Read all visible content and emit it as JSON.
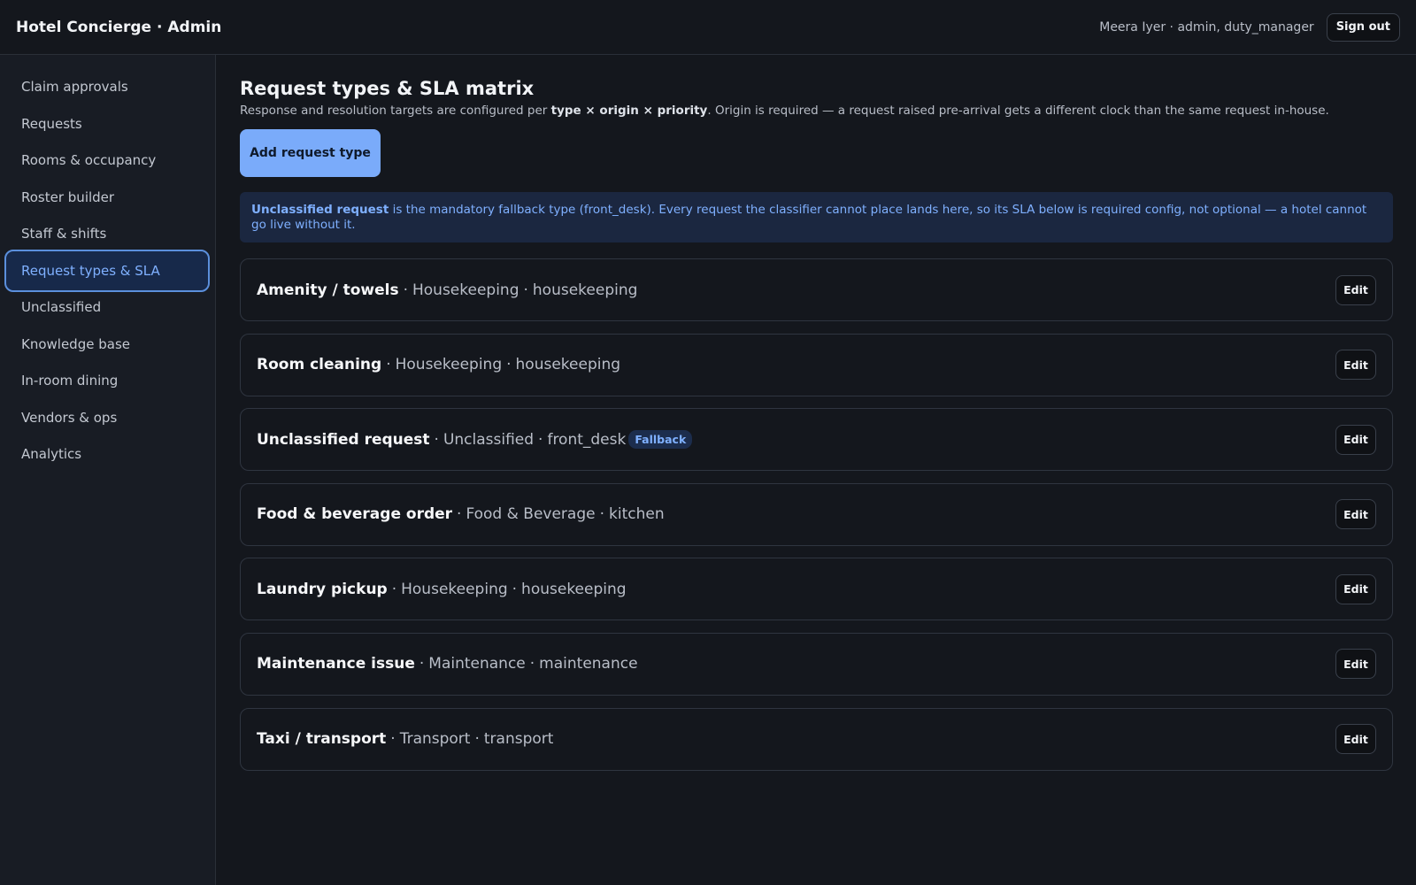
{
  "header": {
    "title": "Hotel Concierge · Admin",
    "user": "Meera Iyer · admin, duty_manager",
    "signout_label": "Sign out"
  },
  "sidebar": {
    "items": [
      {
        "label": "Claim approvals"
      },
      {
        "label": "Requests"
      },
      {
        "label": "Rooms & occupancy"
      },
      {
        "label": "Roster builder"
      },
      {
        "label": "Staff & shifts"
      },
      {
        "label": "Request types & SLA",
        "active": true
      },
      {
        "label": "Unclassified"
      },
      {
        "label": "Knowledge base"
      },
      {
        "label": "In-room dining"
      },
      {
        "label": "Vendors & ops"
      },
      {
        "label": "Analytics"
      }
    ]
  },
  "main": {
    "title": "Request types & SLA matrix",
    "subtitle_prefix": "Response and resolution targets are configured per ",
    "subtitle_bold": "type × origin × priority",
    "subtitle_suffix": ". Origin is required — a request raised pre-arrival gets a different clock than the same request in-house.",
    "add_button_label": "Add request type",
    "notice_bold": "Unclassified request",
    "notice_text": " is the mandatory fallback type (front_desk). Every request the classifier cannot place lands here, so its SLA below is required config, not optional — a hotel cannot go live without it.",
    "edit_label": "Edit",
    "separator": "·",
    "request_types": [
      {
        "name": "Amenity / towels",
        "category": "Housekeeping",
        "team": "housekeeping",
        "badge": ""
      },
      {
        "name": "Room cleaning",
        "category": "Housekeeping",
        "team": "housekeeping",
        "badge": ""
      },
      {
        "name": "Unclassified request",
        "category": "Unclassified",
        "team": "front_desk",
        "badge": "Fallback"
      },
      {
        "name": "Food & beverage order",
        "category": "Food & Beverage",
        "team": "kitchen",
        "badge": ""
      },
      {
        "name": "Laundry pickup",
        "category": "Housekeeping",
        "team": "housekeeping",
        "badge": ""
      },
      {
        "name": "Maintenance issue",
        "category": "Maintenance",
        "team": "maintenance",
        "badge": ""
      },
      {
        "name": "Taxi / transport",
        "category": "Transport",
        "team": "transport",
        "badge": ""
      }
    ]
  },
  "colors": {
    "background": "#14171d",
    "accent": "#7aabfa",
    "active_nav_bg": "#17294a",
    "notice_bg": "#1b2740"
  }
}
